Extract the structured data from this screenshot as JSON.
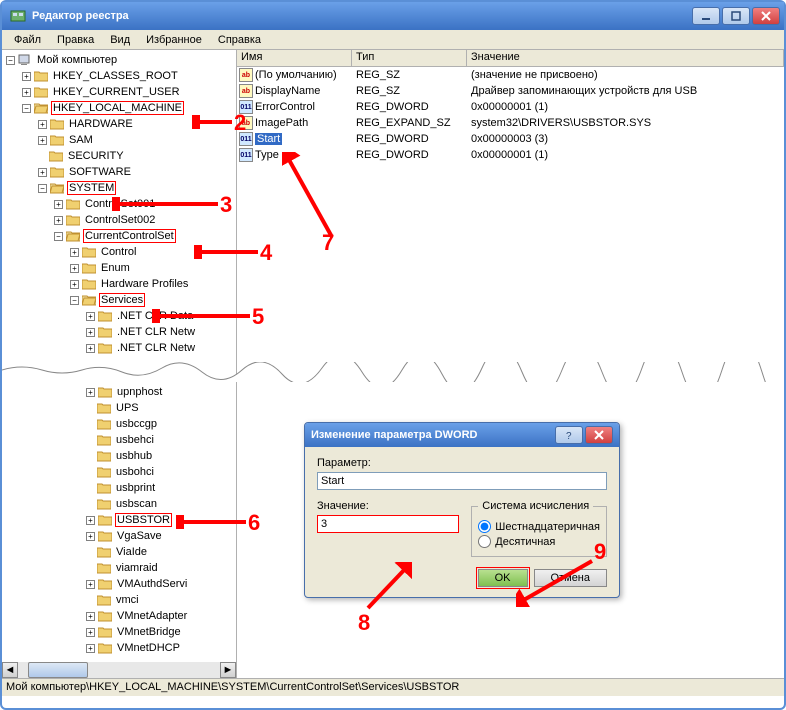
{
  "window": {
    "title": "Редактор реестра"
  },
  "menu": {
    "file": "Файл",
    "edit": "Правка",
    "view": "Вид",
    "favorites": "Избранное",
    "help": "Справка"
  },
  "tree": {
    "root": "Мой компьютер",
    "hkcr": "HKEY_CLASSES_ROOT",
    "hkcu": "HKEY_CURRENT_USER",
    "hklm": "HKEY_LOCAL_MACHINE",
    "hardware": "HARDWARE",
    "sam": "SAM",
    "security": "SECURITY",
    "software": "SOFTWARE",
    "system": "SYSTEM",
    "cs001": "ControlSet001",
    "cs002": "ControlSet002",
    "ccs": "CurrentControlSet",
    "control": "Control",
    "enum": "Enum",
    "hwprofiles": "Hardware Profiles",
    "services": "Services",
    "netclrdata": ".NET CLR Data",
    "netclrnetw": ".NET CLR Netw",
    "netclrother": ".NET CLR Netw",
    "upnphost": "upnphost",
    "ups": "UPS",
    "usbccgp": "usbccgp",
    "usbehci": "usbehci",
    "usbhub": "usbhub",
    "usbohci": "usbohci",
    "usbprint": "usbprint",
    "usbscan": "usbscan",
    "usbstor": "USBSTOR",
    "vgasave": "VgaSave",
    "viaide": "ViaIde",
    "viamraid": "viamraid",
    "vmauthd": "VMAuthdServi",
    "vmci": "vmci",
    "vmnetadapter": "VMnetAdapter",
    "vmnetbridge": "VMnetBridge",
    "vmnetdhcp": "VMnetDHCP"
  },
  "list": {
    "headers": {
      "name": "Имя",
      "type": "Тип",
      "value": "Значение"
    },
    "rows": [
      {
        "name": "(По умолчанию)",
        "type": "REG_SZ",
        "value": "(значение не присвоено)",
        "kind": "str"
      },
      {
        "name": "DisplayName",
        "type": "REG_SZ",
        "value": "Драйвер запоминающих устройств для USB",
        "kind": "str"
      },
      {
        "name": "ErrorControl",
        "type": "REG_DWORD",
        "value": "0x00000001 (1)",
        "kind": "bin"
      },
      {
        "name": "ImagePath",
        "type": "REG_EXPAND_SZ",
        "value": "system32\\DRIVERS\\USBSTOR.SYS",
        "kind": "str"
      },
      {
        "name": "Start",
        "type": "REG_DWORD",
        "value": "0x00000003 (3)",
        "kind": "bin",
        "selected": true
      },
      {
        "name": "Type",
        "type": "REG_DWORD",
        "value": "0x00000001 (1)",
        "kind": "bin"
      }
    ]
  },
  "dialog": {
    "title": "Изменение параметра DWORD",
    "param_label": "Параметр:",
    "param_value": "Start",
    "value_label": "Значение:",
    "value_value": "3",
    "base_legend": "Система исчисления",
    "hex": "Шестнадцатеричная",
    "dec": "Десятичная",
    "ok": "OK",
    "cancel": "Отмена"
  },
  "statusbar": "Мой компьютер\\HKEY_LOCAL_MACHINE\\SYSTEM\\CurrentControlSet\\Services\\USBSTOR",
  "annotations": {
    "n2": "2",
    "n3": "3",
    "n4": "4",
    "n5": "5",
    "n6": "6",
    "n7": "7",
    "n8": "8",
    "n9": "9"
  }
}
